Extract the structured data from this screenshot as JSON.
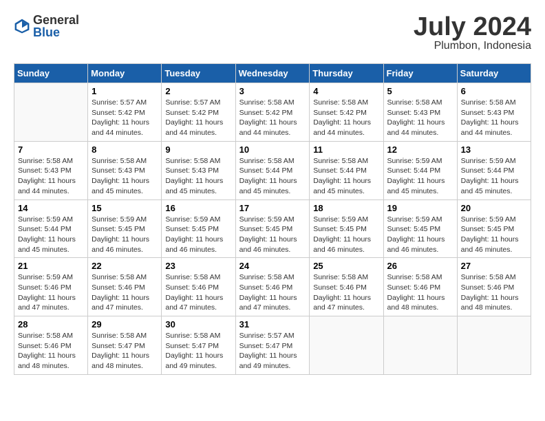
{
  "header": {
    "logo_general": "General",
    "logo_blue": "Blue",
    "month": "July 2024",
    "location": "Plumbon, Indonesia"
  },
  "days_of_week": [
    "Sunday",
    "Monday",
    "Tuesday",
    "Wednesday",
    "Thursday",
    "Friday",
    "Saturday"
  ],
  "weeks": [
    [
      {
        "day": "",
        "info": ""
      },
      {
        "day": "1",
        "info": "Sunrise: 5:57 AM\nSunset: 5:42 PM\nDaylight: 11 hours\nand 44 minutes."
      },
      {
        "day": "2",
        "info": "Sunrise: 5:57 AM\nSunset: 5:42 PM\nDaylight: 11 hours\nand 44 minutes."
      },
      {
        "day": "3",
        "info": "Sunrise: 5:58 AM\nSunset: 5:42 PM\nDaylight: 11 hours\nand 44 minutes."
      },
      {
        "day": "4",
        "info": "Sunrise: 5:58 AM\nSunset: 5:42 PM\nDaylight: 11 hours\nand 44 minutes."
      },
      {
        "day": "5",
        "info": "Sunrise: 5:58 AM\nSunset: 5:43 PM\nDaylight: 11 hours\nand 44 minutes."
      },
      {
        "day": "6",
        "info": "Sunrise: 5:58 AM\nSunset: 5:43 PM\nDaylight: 11 hours\nand 44 minutes."
      }
    ],
    [
      {
        "day": "7",
        "info": "Sunrise: 5:58 AM\nSunset: 5:43 PM\nDaylight: 11 hours\nand 44 minutes."
      },
      {
        "day": "8",
        "info": "Sunrise: 5:58 AM\nSunset: 5:43 PM\nDaylight: 11 hours\nand 45 minutes."
      },
      {
        "day": "9",
        "info": "Sunrise: 5:58 AM\nSunset: 5:43 PM\nDaylight: 11 hours\nand 45 minutes."
      },
      {
        "day": "10",
        "info": "Sunrise: 5:58 AM\nSunset: 5:44 PM\nDaylight: 11 hours\nand 45 minutes."
      },
      {
        "day": "11",
        "info": "Sunrise: 5:58 AM\nSunset: 5:44 PM\nDaylight: 11 hours\nand 45 minutes."
      },
      {
        "day": "12",
        "info": "Sunrise: 5:59 AM\nSunset: 5:44 PM\nDaylight: 11 hours\nand 45 minutes."
      },
      {
        "day": "13",
        "info": "Sunrise: 5:59 AM\nSunset: 5:44 PM\nDaylight: 11 hours\nand 45 minutes."
      }
    ],
    [
      {
        "day": "14",
        "info": "Sunrise: 5:59 AM\nSunset: 5:44 PM\nDaylight: 11 hours\nand 45 minutes."
      },
      {
        "day": "15",
        "info": "Sunrise: 5:59 AM\nSunset: 5:45 PM\nDaylight: 11 hours\nand 46 minutes."
      },
      {
        "day": "16",
        "info": "Sunrise: 5:59 AM\nSunset: 5:45 PM\nDaylight: 11 hours\nand 46 minutes."
      },
      {
        "day": "17",
        "info": "Sunrise: 5:59 AM\nSunset: 5:45 PM\nDaylight: 11 hours\nand 46 minutes."
      },
      {
        "day": "18",
        "info": "Sunrise: 5:59 AM\nSunset: 5:45 PM\nDaylight: 11 hours\nand 46 minutes."
      },
      {
        "day": "19",
        "info": "Sunrise: 5:59 AM\nSunset: 5:45 PM\nDaylight: 11 hours\nand 46 minutes."
      },
      {
        "day": "20",
        "info": "Sunrise: 5:59 AM\nSunset: 5:45 PM\nDaylight: 11 hours\nand 46 minutes."
      }
    ],
    [
      {
        "day": "21",
        "info": "Sunrise: 5:59 AM\nSunset: 5:46 PM\nDaylight: 11 hours\nand 47 minutes."
      },
      {
        "day": "22",
        "info": "Sunrise: 5:58 AM\nSunset: 5:46 PM\nDaylight: 11 hours\nand 47 minutes."
      },
      {
        "day": "23",
        "info": "Sunrise: 5:58 AM\nSunset: 5:46 PM\nDaylight: 11 hours\nand 47 minutes."
      },
      {
        "day": "24",
        "info": "Sunrise: 5:58 AM\nSunset: 5:46 PM\nDaylight: 11 hours\nand 47 minutes."
      },
      {
        "day": "25",
        "info": "Sunrise: 5:58 AM\nSunset: 5:46 PM\nDaylight: 11 hours\nand 47 minutes."
      },
      {
        "day": "26",
        "info": "Sunrise: 5:58 AM\nSunset: 5:46 PM\nDaylight: 11 hours\nand 48 minutes."
      },
      {
        "day": "27",
        "info": "Sunrise: 5:58 AM\nSunset: 5:46 PM\nDaylight: 11 hours\nand 48 minutes."
      }
    ],
    [
      {
        "day": "28",
        "info": "Sunrise: 5:58 AM\nSunset: 5:46 PM\nDaylight: 11 hours\nand 48 minutes."
      },
      {
        "day": "29",
        "info": "Sunrise: 5:58 AM\nSunset: 5:47 PM\nDaylight: 11 hours\nand 48 minutes."
      },
      {
        "day": "30",
        "info": "Sunrise: 5:58 AM\nSunset: 5:47 PM\nDaylight: 11 hours\nand 49 minutes."
      },
      {
        "day": "31",
        "info": "Sunrise: 5:57 AM\nSunset: 5:47 PM\nDaylight: 11 hours\nand 49 minutes."
      },
      {
        "day": "",
        "info": ""
      },
      {
        "day": "",
        "info": ""
      },
      {
        "day": "",
        "info": ""
      }
    ]
  ]
}
